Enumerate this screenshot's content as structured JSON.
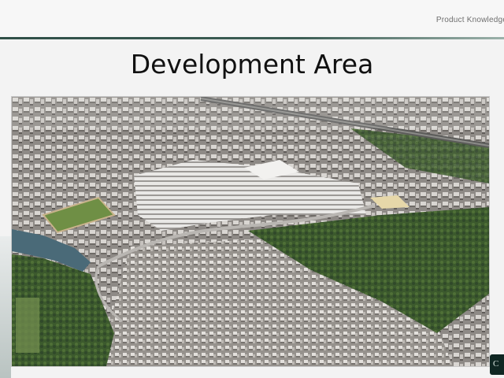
{
  "header": {
    "section_label": "Product Knowledge"
  },
  "slide": {
    "title": "Development Area"
  },
  "photo": {
    "alt": "Aerial 3D render of development area"
  },
  "colors": {
    "accent": "#2f4f47",
    "background": "#f3f3f3"
  }
}
